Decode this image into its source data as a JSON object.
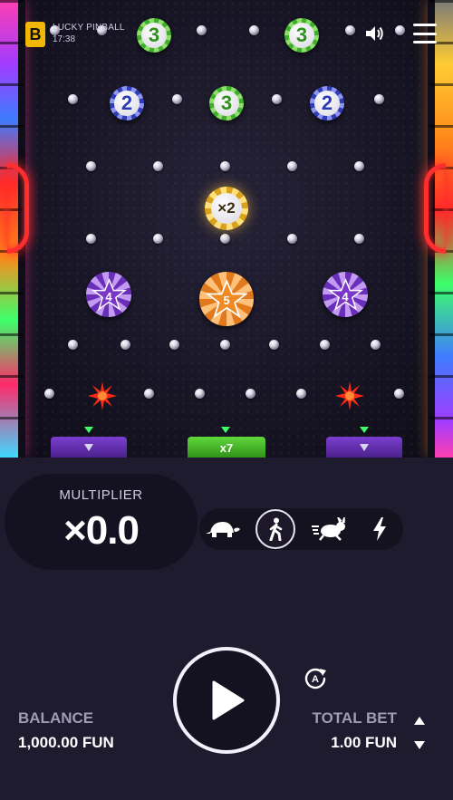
{
  "header": {
    "logo_letter": "B",
    "game_title": "LUCKY PINBALL",
    "time": "17:38"
  },
  "board": {
    "top_chips": [
      {
        "label": "3",
        "color": "green"
      },
      {
        "label": "3",
        "color": "green"
      }
    ],
    "row2_chips": [
      {
        "label": "2",
        "color": "blue"
      },
      {
        "label": "3",
        "color": "green"
      },
      {
        "label": "2",
        "color": "blue"
      }
    ],
    "multiplier_chip": {
      "label": "×2",
      "color": "gold"
    },
    "star_chips": [
      {
        "label": "4",
        "color": "purple"
      },
      {
        "label": "5",
        "color": "orange"
      },
      {
        "label": "4",
        "color": "purple"
      }
    ],
    "slots": [
      {
        "label": "",
        "color": "purple"
      },
      {
        "label": "x7",
        "color": "green"
      },
      {
        "label": "",
        "color": "purple"
      }
    ]
  },
  "multiplier": {
    "label": "MULTIPLIER",
    "value": "×0.0"
  },
  "speeds": [
    {
      "name": "turtle-icon",
      "active": false
    },
    {
      "name": "walk-icon",
      "active": true
    },
    {
      "name": "rabbit-icon",
      "active": false
    },
    {
      "name": "lightning-icon",
      "active": false
    }
  ],
  "balance": {
    "label": "BALANCE",
    "value": "1,000.00 FUN"
  },
  "bet": {
    "label": "TOTAL BET",
    "value": "1.00 FUN"
  },
  "colors": {
    "background": "#1f1b2e",
    "panel": "#141121",
    "accent_green": "#3cff6a",
    "bumper_red": "#ff2e2e"
  }
}
